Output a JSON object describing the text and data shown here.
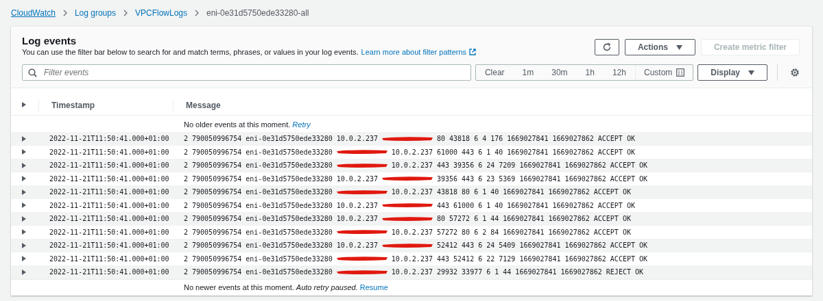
{
  "breadcrumbs": [
    {
      "label": "CloudWatch",
      "kind": "link"
    },
    {
      "label": "Log groups",
      "kind": "link"
    },
    {
      "label": "VPCFlowLogs",
      "kind": "link"
    },
    {
      "label": "eni-0e31d5750ede33280-all",
      "kind": "current"
    }
  ],
  "panel": {
    "title": "Log events",
    "description": "You can use the filter bar below to search for and match terms, phrases, or values in your log events.",
    "learn_more": "Learn more about filter patterns",
    "actions": [
      {
        "kind": "refresh",
        "disabled": false
      },
      {
        "label": "Actions",
        "kind": "dropdown",
        "disabled": false
      },
      {
        "label": "Create metric filter",
        "kind": "plain",
        "disabled": true
      }
    ]
  },
  "filter": {
    "placeholder": "Filter events",
    "ranges": [
      {
        "label": "Clear",
        "selected": false
      },
      {
        "label": "1m",
        "selected": false
      },
      {
        "label": "30m",
        "selected": false
      },
      {
        "label": "1h",
        "selected": false
      },
      {
        "label": "12h",
        "selected": false
      },
      {
        "label": "Custom",
        "selected": false
      }
    ],
    "display": "Display"
  },
  "table": {
    "columns": [
      "Timestamp",
      "Message"
    ],
    "older": {
      "text": "No older events at this moment.",
      "link": "Retry"
    },
    "rows": [
      {
        "expanded": false,
        "timestamp": "2022-11-21T11:50:41.000+01:00",
        "before": "2 790050996754 eni-0e31d5750ede33280 10.0.2.237",
        "after": "80 43818 6 4 176 1669027841 1669027862 ACCEPT OK"
      },
      {
        "expanded": false,
        "timestamp": "2022-11-21T11:50:41.000+01:00",
        "before": "2 790050996754 eni-0e31d5750ede33280",
        "after": "10.0.2.237 61000 443 6 1 40 1669027841 1669027862 ACCEPT OK"
      },
      {
        "expanded": false,
        "timestamp": "2022-11-21T11:50:41.000+01:00",
        "before": "2 790050996754 eni-0e31d5750ede33280",
        "after": "10.0.2.237 443 39356 6 24 7209 1669027841 1669027862 ACCEPT OK"
      },
      {
        "expanded": false,
        "timestamp": "2022-11-21T11:50:41.000+01:00",
        "before": "2 790050996754 eni-0e31d5750ede33280 10.0.2.237",
        "after": "39356 443 6 23 5369 1669027841 1669027862 ACCEPT OK"
      },
      {
        "expanded": false,
        "timestamp": "2022-11-21T11:50:41.000+01:00",
        "before": "2 790050996754 eni-0e31d5750ede33280",
        "after": "10.0.2.237 43818 80 6 1 40 1669027841 1669027862 ACCEPT OK"
      },
      {
        "expanded": false,
        "timestamp": "2022-11-21T11:50:41.000+01:00",
        "before": "2 790050996754 eni-0e31d5750ede33280 10.0.2.237",
        "after": "443 61000 6 1 40 1669027841 1669027862 ACCEPT OK"
      },
      {
        "expanded": false,
        "timestamp": "2022-11-21T11:50:41.000+01:00",
        "before": "2 790050996754 eni-0e31d5750ede33280 10.0.2.237",
        "after": "80 57272 6 1 44 1669027841 1669027862 ACCEPT OK"
      },
      {
        "expanded": false,
        "timestamp": "2022-11-21T11:50:41.000+01:00",
        "before": "2 790050996754 eni-0e31d5750ede33280",
        "after": "10.0.2.237 57272 80 6 2 84 1669027841 1669027862 ACCEPT OK"
      },
      {
        "expanded": false,
        "timestamp": "2022-11-21T11:50:41.000+01:00",
        "before": "2 790050996754 eni-0e31d5750ede33280 10.0.2.237",
        "after": "52412 443 6 24 5409 1669027841 1669027862 ACCEPT OK"
      },
      {
        "expanded": false,
        "timestamp": "2022-11-21T11:50:41.000+01:00",
        "before": "2 790050996754 eni-0e31d5750ede33280",
        "after": "10.0.2.237 443 52412 6 22 7129 1669027841 1669027862 ACCEPT OK"
      },
      {
        "expanded": false,
        "timestamp": "2022-11-21T11:50:41.000+01:00",
        "before": "2 790050996754 eni-0e31d5750ede33280",
        "after": "10.0.2.237 29932 33977 6 1 44 1669027841 1669027862 REJECT OK"
      }
    ],
    "newer": {
      "text": "No newer events at this moment.",
      "note": "Auto retry paused.",
      "link": "Resume"
    }
  }
}
